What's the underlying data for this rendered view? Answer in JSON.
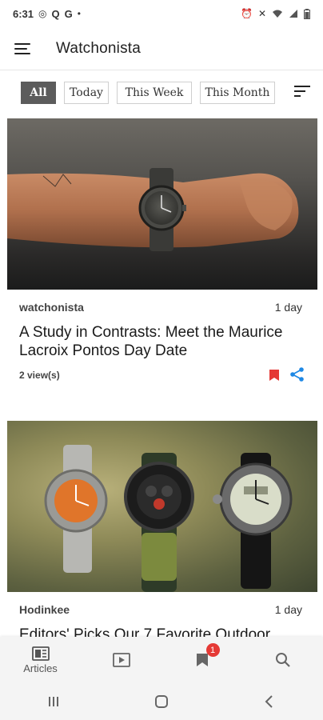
{
  "status_bar": {
    "time": "6:31",
    "left_icons": [
      "camera-icon",
      "q-icon",
      "google-icon",
      "dot-icon"
    ],
    "right_icons": [
      "alarm-icon",
      "mute-icon",
      "wifi-icon",
      "signal-icon",
      "battery-icon"
    ]
  },
  "app_bar": {
    "title": "Watchonista"
  },
  "filters": {
    "chips": [
      "All",
      "Today",
      "This Week",
      "This Month"
    ],
    "active": "All"
  },
  "feed": [
    {
      "source": "watchonista",
      "time": "1 day",
      "title": "A Study in Contrasts: Meet the Maurice Lacroix Pontos Day Date",
      "views": "2 view(s)",
      "bookmarked": true,
      "accent_bookmark": "#e53935",
      "accent_share": "#1e88e5"
    },
    {
      "source": "Hodinkee",
      "time": "1 day",
      "title": "Editors' Picks Our 7 Favorite Outdoor"
    }
  ],
  "bottom_nav": {
    "items": [
      {
        "label": "Articles",
        "icon": "articles-icon"
      },
      {
        "label": "",
        "icon": "video-icon"
      },
      {
        "label": "",
        "icon": "bookmark-icon",
        "badge": "1"
      },
      {
        "label": "",
        "icon": "search-icon"
      }
    ]
  },
  "system_nav": [
    "recents-icon",
    "home-icon",
    "back-icon"
  ]
}
